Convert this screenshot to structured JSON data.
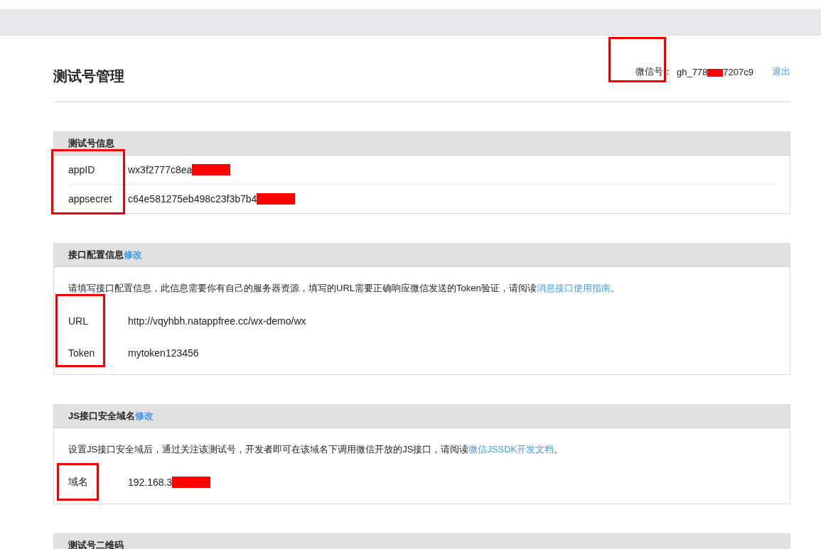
{
  "page": {
    "title": "测试号管理"
  },
  "account": {
    "label": "微信号：",
    "value_start": "gh_778",
    "redacted": true,
    "value_end": "7207c9",
    "outlined": true,
    "logout": "退出"
  },
  "sections": [
    {
      "title": "测试号信息",
      "labels_outlined": true,
      "divided": true,
      "rows": [
        {
          "label": "appID",
          "value": "wx3f2777c8ea",
          "redacted": true
        },
        {
          "label": "appsecret",
          "value": "c64e581275eb498c23f3b7b4",
          "redacted": true
        }
      ]
    },
    {
      "title": "接口配置信息",
      "edit_link": "修改",
      "description": "请填写接口配置信息，此信息需要你有自己的服务器资源，填写的URL需要正确响应微信发送的Token验证，请阅读",
      "doc_link": "消息接口使用指南",
      "tail": "。",
      "labels_outlined": true,
      "divided": false,
      "rows": [
        {
          "label": "URL",
          "value": "http://vqyhbh.natappfree.cc/wx-demo/wx",
          "redacted": false
        },
        {
          "label": "Token",
          "value": "mytoken123456",
          "redacted": false
        }
      ]
    },
    {
      "title": "JS接口安全域名",
      "edit_link": "修改",
      "description": "设置JS接口安全域后，通过关注该测试号，开发者即可在该域名下调用微信开放的JS接口，请阅读",
      "doc_link": "微信JSSDK开发文档",
      "tail": "。",
      "labels_outlined": true,
      "divided": false,
      "rows": [
        {
          "label": "域名",
          "value": "192.168.3",
          "redacted": true
        }
      ]
    },
    {
      "title": "测试号二维码"
    }
  ]
}
